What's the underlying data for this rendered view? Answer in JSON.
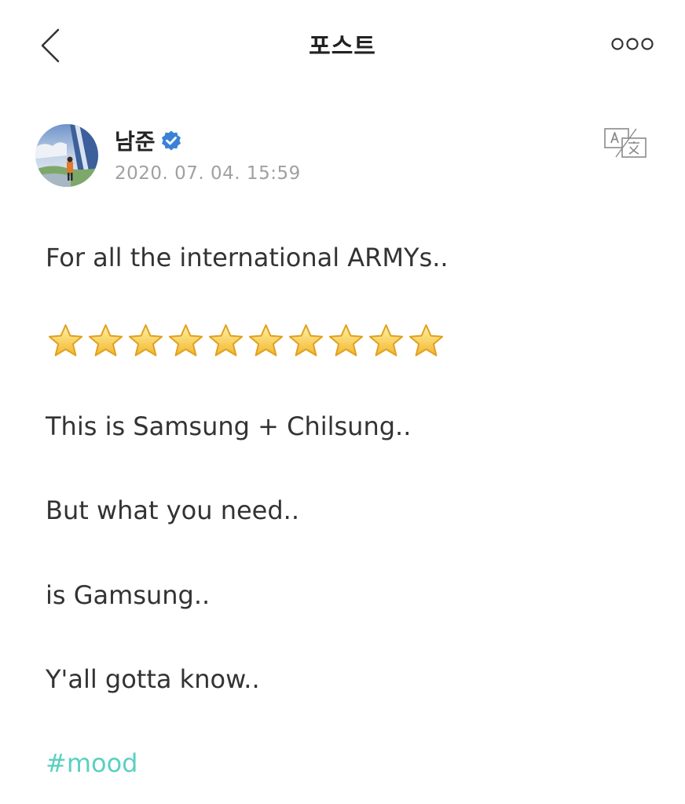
{
  "header": {
    "title": "포스트",
    "back_icon": "chevron-left-icon",
    "more_icon": "more-dots-icon"
  },
  "author": {
    "name": "남준",
    "verified": true,
    "timestamp": "2020. 07. 04. 15:59",
    "translate_icon": "translate-icon"
  },
  "post": {
    "lines": [
      "For all the international ARMYs..",
      "This is Samsung + Chilsung..",
      "But what you need..",
      "is Gamsung..",
      "Y'all gotta know.."
    ],
    "star_count": 10,
    "star_icon": "star-emoji-icon",
    "hashtag": "#mood"
  },
  "colors": {
    "accent": "#5bd0c0",
    "verified_badge": "#3b82d6",
    "text": "#333333",
    "muted": "#a0a0a0"
  }
}
